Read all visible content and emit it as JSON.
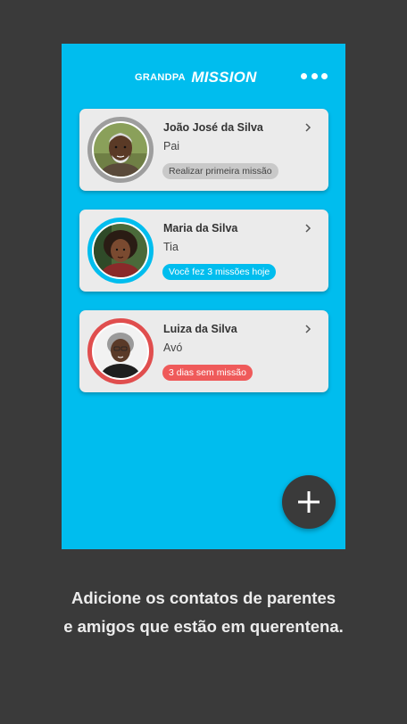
{
  "app": {
    "logo_small": "GRANDPA",
    "logo_big": "MISSION",
    "menu_icon": "more-horizontal-icon"
  },
  "contacts": [
    {
      "name": "João José da Silva",
      "relation": "Pai",
      "status": "Realizar primeira missão",
      "ring_color": "#9e9e9e",
      "badge_bg": "#c9c9c9",
      "badge_color": "#444444"
    },
    {
      "name": "Maria da Silva",
      "relation": "Tia",
      "status": "Você fez 3 missões hoje",
      "ring_color": "#00bdee",
      "badge_bg": "#00bdee",
      "badge_color": "#ffffff"
    },
    {
      "name": "Luiza da Silva",
      "relation": "Avó",
      "status": "3 dias sem missão",
      "ring_color": "#e04e4e",
      "badge_bg": "#ef5a5a",
      "badge_color": "#ffffff"
    }
  ],
  "fab": {
    "icon": "plus-icon"
  },
  "caption": {
    "line1": "Adicione os contatos de parentes",
    "line2": "e amigos que estão em querentena."
  },
  "colors": {
    "screen_bg": "#00bdee",
    "outer_bg": "#3a3a3a",
    "card_bg": "#ebebeb"
  }
}
